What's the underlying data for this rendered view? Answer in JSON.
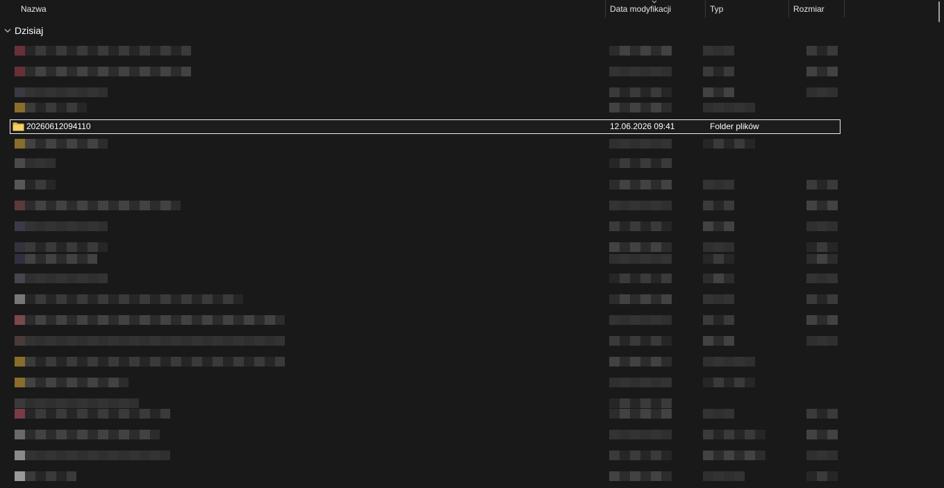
{
  "columns": {
    "name": "Nazwa",
    "date": "Data modyfikacji",
    "type": "Typ",
    "size": "Rozmiar"
  },
  "group": {
    "label": "Dzisiaj",
    "icon": "chevron-down-icon"
  },
  "selected_item": {
    "name": "20260612094110",
    "date": "12.06.2026 09:41",
    "type": "Folder plików",
    "icon": "folder-icon",
    "icon_color": "#f0c24a"
  },
  "colors": {
    "background": "#191919",
    "selection_border": "#f0f0f0",
    "text": "#ffffff",
    "pixelated_dark": "#2b2b2b",
    "pixelated_mid": "#3a3a3a",
    "pixelated_light": "#4a4a4a"
  }
}
